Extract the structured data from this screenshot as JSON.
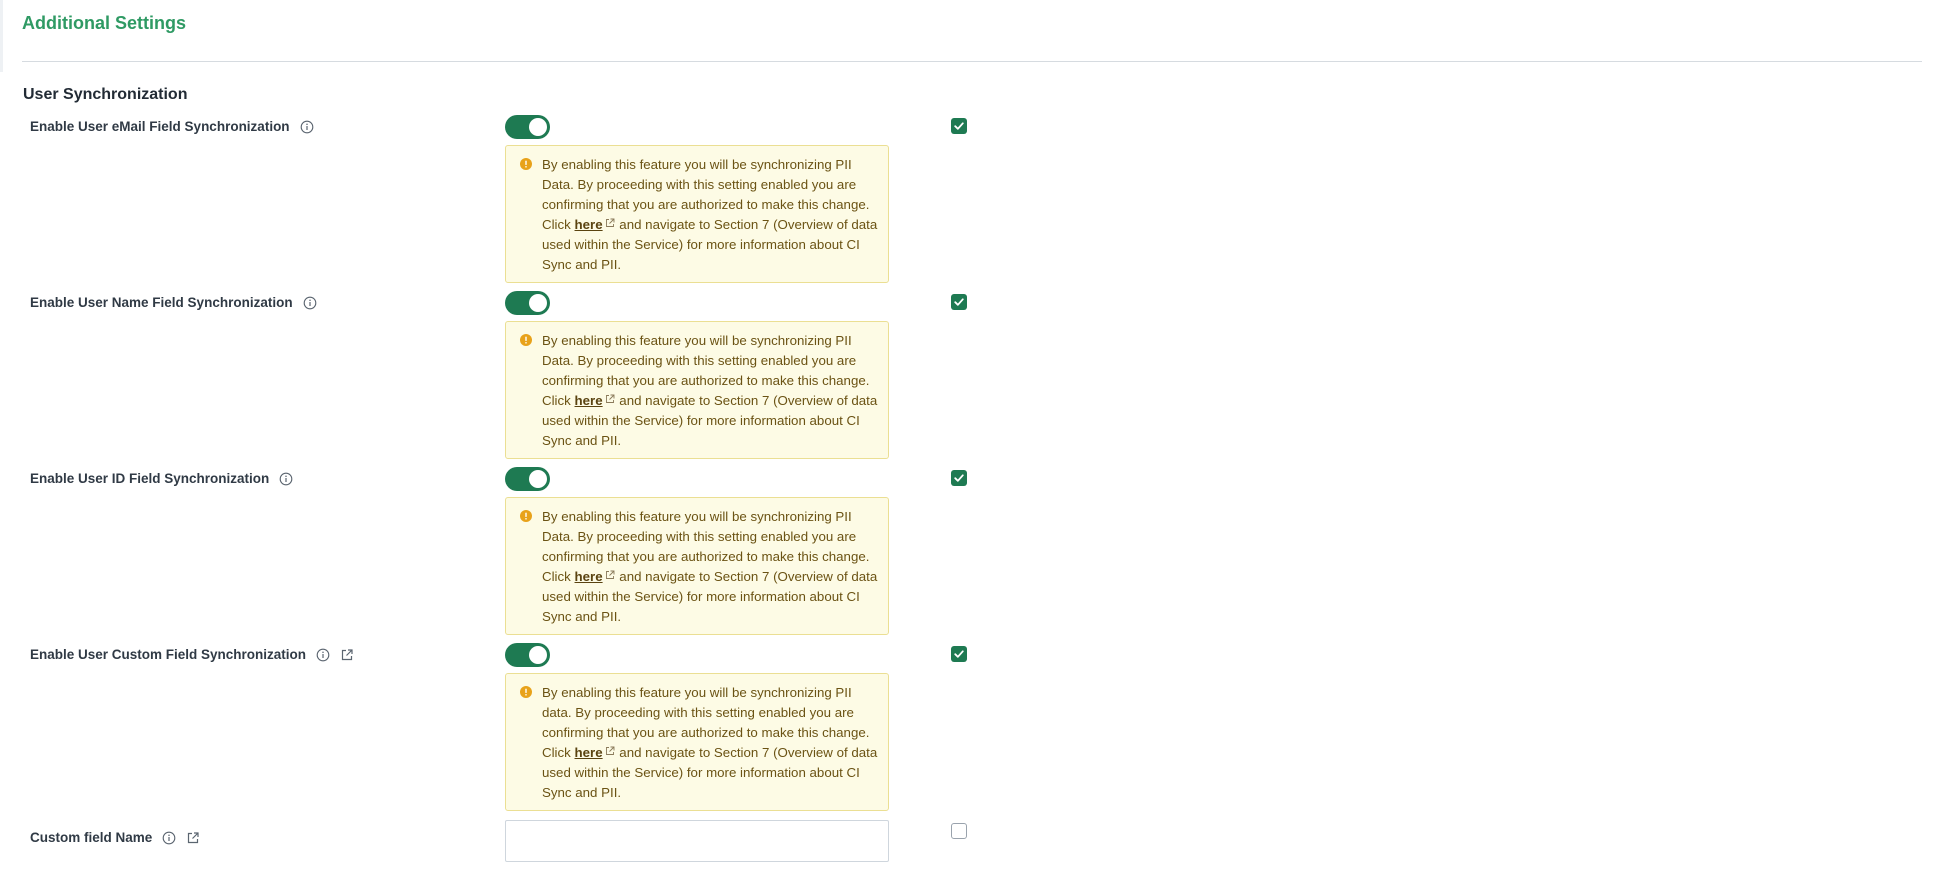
{
  "header": {
    "title": "Additional Settings"
  },
  "section": {
    "title": "User Synchronization"
  },
  "rows": [
    {
      "label": "Enable User eMail Field Synchronization",
      "toggle_on": true,
      "checked": true,
      "warning": {
        "before": "By enabling this feature you will be synchronizing PII Data. By proceeding with this setting enabled you are confirming that you are authorized to make this change. Click ",
        "link": "here",
        "after": " and navigate to Section 7 (Overview of data used within the Service) for more information about CI Sync and PII."
      }
    },
    {
      "label": "Enable User Name Field Synchronization",
      "toggle_on": true,
      "checked": true,
      "warning": {
        "before": "By enabling this feature you will be synchronizing PII Data. By proceeding with this setting enabled you are confirming that you are authorized to make this change. Click ",
        "link": "here",
        "after": " and navigate to Section 7 (Overview of data used within the Service) for more information about CI Sync and PII."
      }
    },
    {
      "label": "Enable User ID Field Synchronization",
      "toggle_on": true,
      "checked": true,
      "warning": {
        "before": "By enabling this feature you will be synchronizing PII Data. By proceeding with this setting enabled you are confirming that you are authorized to make this change. Click ",
        "link": "here",
        "after": " and navigate to Section 7 (Overview of data used within the Service) for more information about CI Sync and PII."
      }
    },
    {
      "label": "Enable User Custom Field Synchronization",
      "toggle_on": true,
      "checked": true,
      "warning": {
        "before": "By enabling this feature you will be synchronizing PII data. By proceeding with this setting enabled you are confirming that you are authorized to make this change. Click ",
        "link": "here",
        "after": " and navigate to Section 7 (Overview of data used within the Service) for more information about CI Sync and PII."
      }
    }
  ],
  "custom_field": {
    "label": "Custom field Name",
    "value": "",
    "placeholder": "",
    "checked": false
  },
  "icons": {
    "info": "info-circle-icon",
    "external": "external-link-icon",
    "warning": "warning-circle-icon",
    "check": "checkmark-icon"
  },
  "colors": {
    "accent": "#1e7a52",
    "title": "#2f9a64",
    "warning_bg": "#fdfbe5",
    "warning_border": "#ebdf93",
    "warning_icon": "#e8a21a"
  }
}
